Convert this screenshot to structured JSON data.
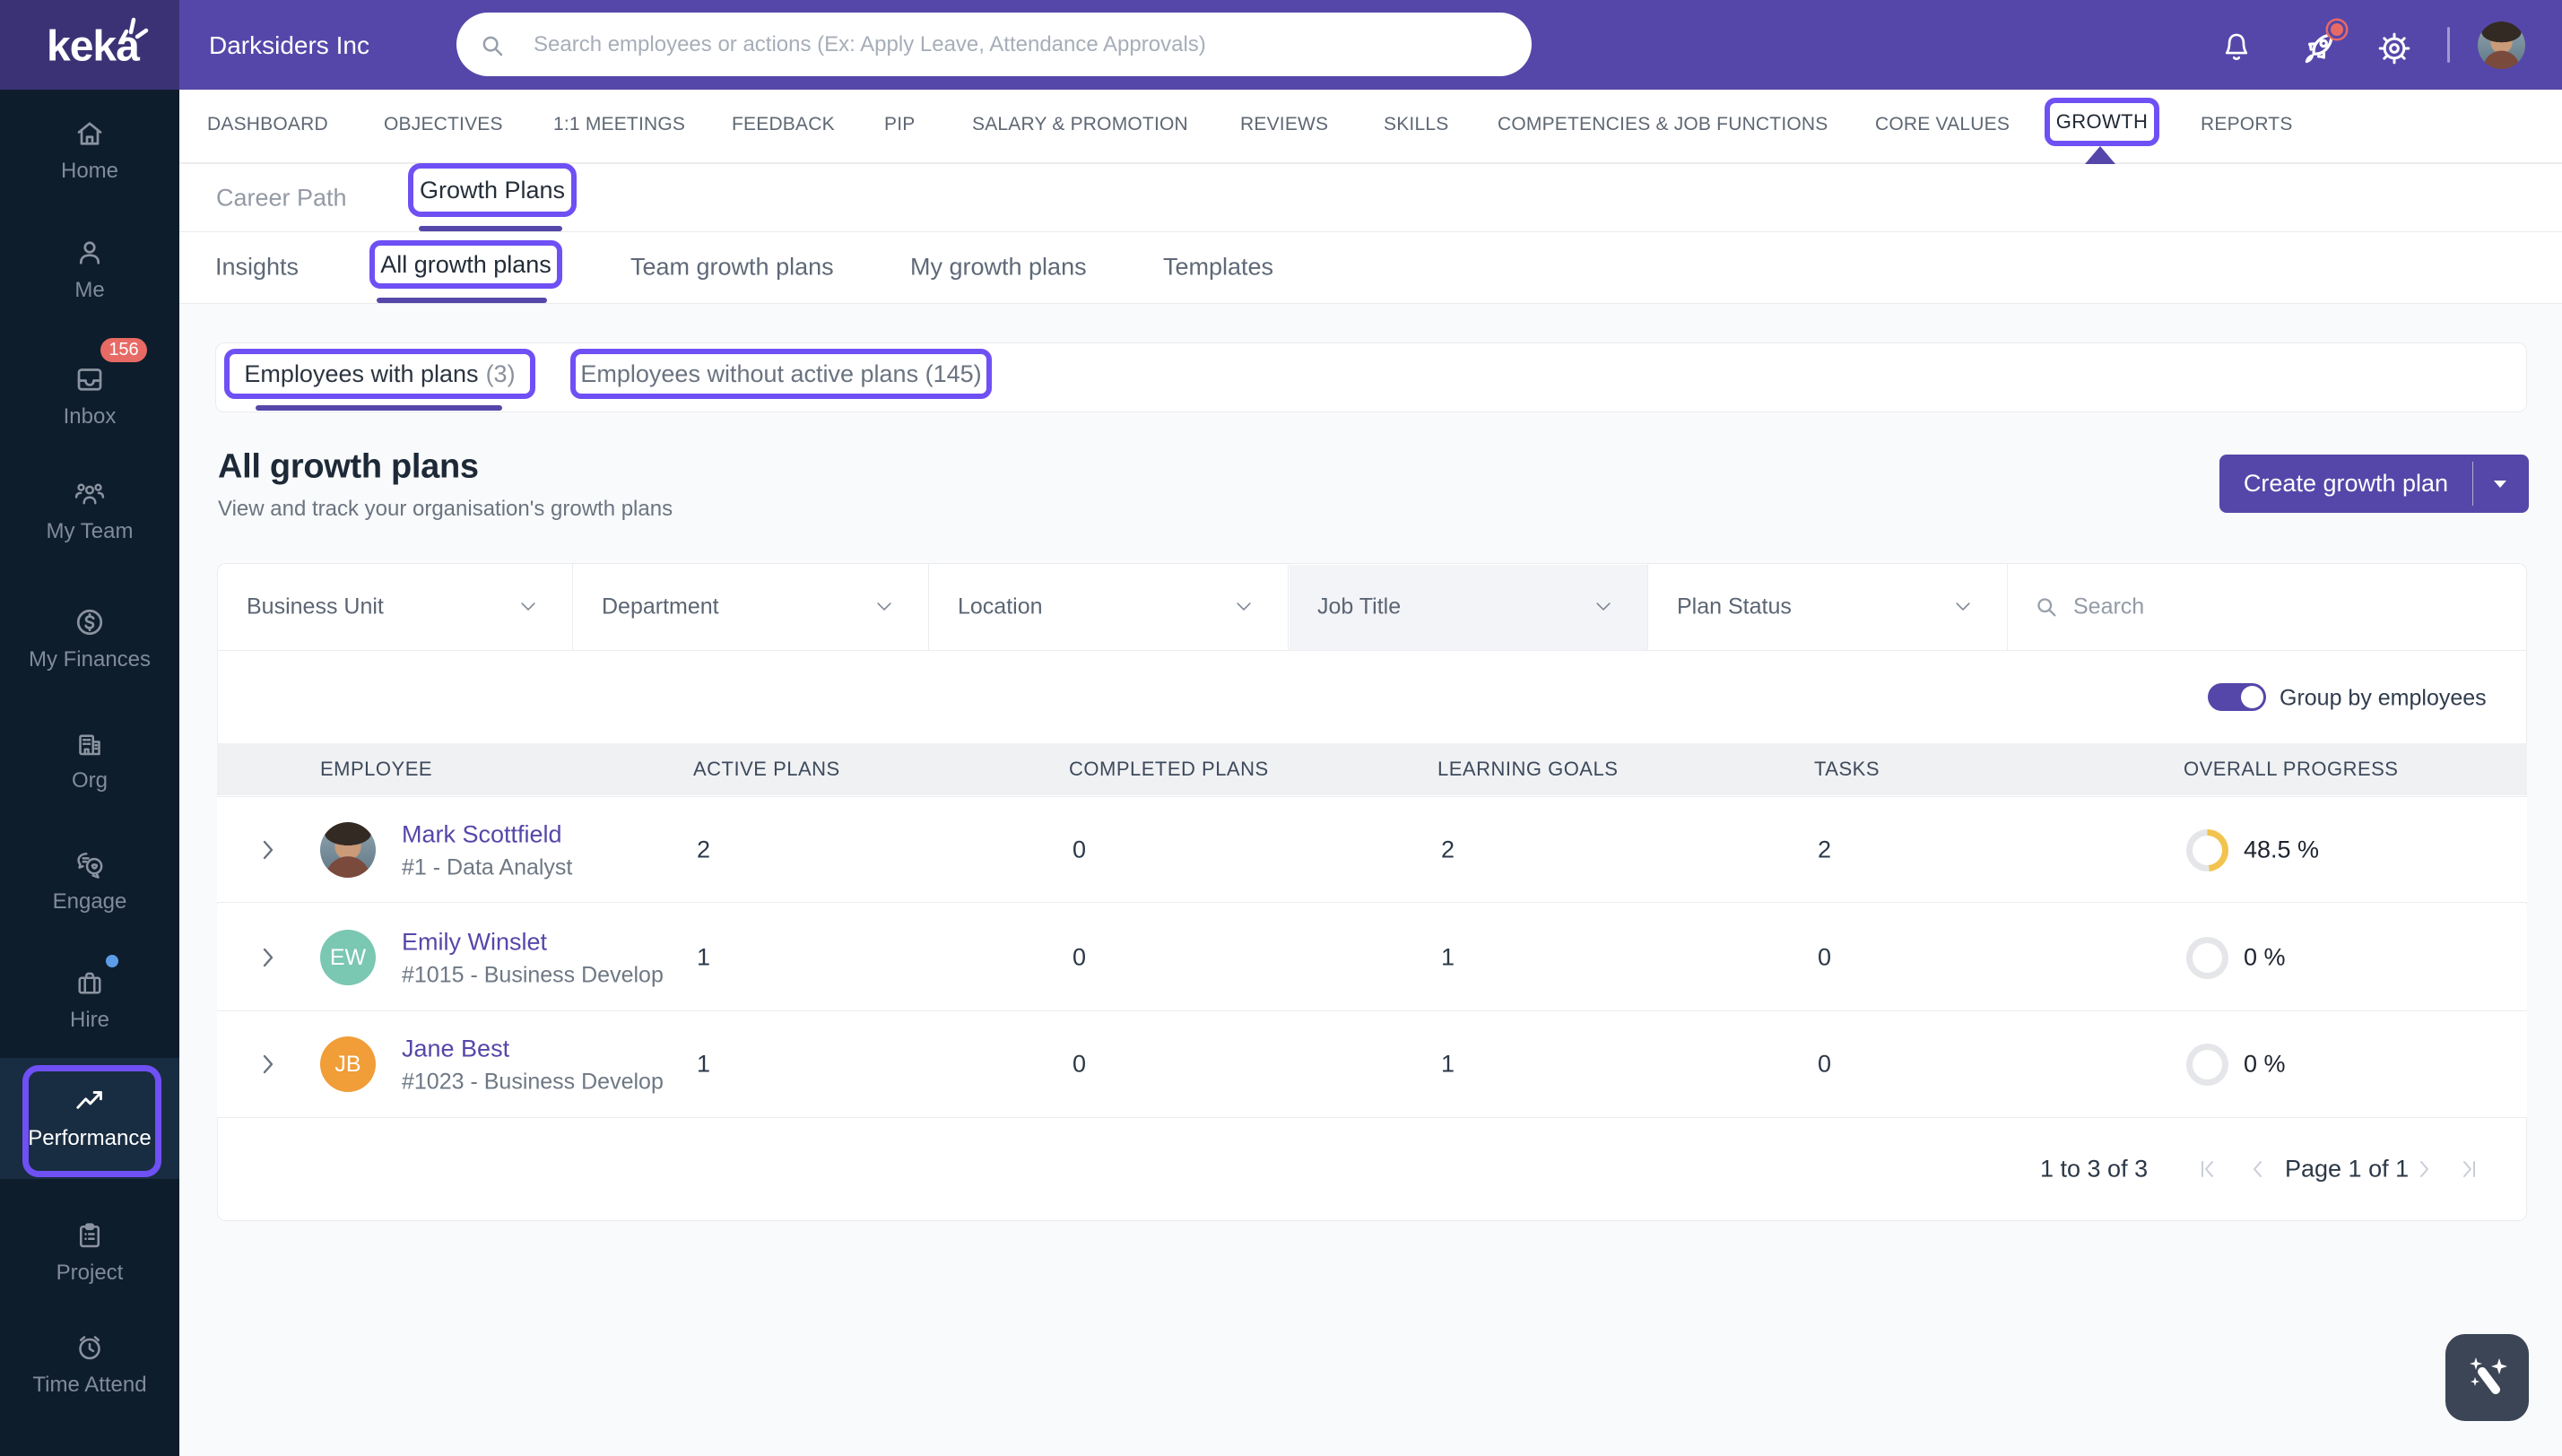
{
  "header": {
    "logo": "keka",
    "company": "Darksiders Inc",
    "search_placeholder": "Search employees or actions (Ex: Apply Leave, Attendance Approvals)",
    "chat_badge_dot": true
  },
  "sidebar": {
    "items": [
      {
        "label": "Home"
      },
      {
        "label": "Me"
      },
      {
        "label": "Inbox",
        "badge": "156"
      },
      {
        "label": "My Team"
      },
      {
        "label": "My Finances"
      },
      {
        "label": "Org"
      },
      {
        "label": "Engage"
      },
      {
        "label": "Hire",
        "dot": true
      },
      {
        "label": "Performance",
        "active": true
      },
      {
        "label": "Project"
      },
      {
        "label": "Time Attend"
      }
    ]
  },
  "nav": {
    "items": [
      "DASHBOARD",
      "OBJECTIVES",
      "1:1 MEETINGS",
      "FEEDBACK",
      "PIP",
      "SALARY & PROMOTION",
      "REVIEWS",
      "SKILLS",
      "COMPETENCIES & JOB FUNCTIONS",
      "CORE VALUES",
      "GROWTH",
      "REPORTS"
    ],
    "active": "GROWTH"
  },
  "subnav": {
    "items": [
      "Career Path",
      "Growth Plans"
    ],
    "active": "Growth Plans"
  },
  "tabs": {
    "items": [
      "Insights",
      "All growth plans",
      "Team growth plans",
      "My growth plans",
      "Templates"
    ],
    "active": "All growth plans"
  },
  "employee_tabs": {
    "with_plans_label": "Employees with plans",
    "with_plans_count": "(3)",
    "without_plans_label": "Employees without active plans (145)"
  },
  "page": {
    "title": "All growth plans",
    "subtitle": "View and track your organisation's growth plans",
    "create_button": "Create growth plan"
  },
  "filters": {
    "items": [
      "Business Unit",
      "Department",
      "Location",
      "Job Title",
      "Plan Status"
    ],
    "search_placeholder": "Search"
  },
  "toggle": {
    "label": "Group by employees",
    "on": true
  },
  "table": {
    "columns": [
      "EMPLOYEE",
      "ACTIVE PLANS",
      "COMPLETED PLANS",
      "LEARNING GOALS",
      "TASKS",
      "OVERALL PROGRESS"
    ],
    "rows": [
      {
        "name": "Mark Scottfield",
        "meta": "#1 - Data Analyst",
        "initials": "",
        "avatar": "photo",
        "active_plans": "2",
        "completed_plans": "0",
        "learning_goals": "2",
        "tasks": "2",
        "progress_label": "48.5 %",
        "progress_pct": 48.5
      },
      {
        "name": "Emily Winslet",
        "meta": "#1015 - Business Develop",
        "initials": "EW",
        "avatar": "#7ac7b2",
        "active_plans": "1",
        "completed_plans": "0",
        "learning_goals": "1",
        "tasks": "0",
        "progress_label": "0 %",
        "progress_pct": 0
      },
      {
        "name": "Jane Best",
        "meta": "#1023 - Business Develop",
        "initials": "JB",
        "avatar": "#f19d38",
        "active_plans": "1",
        "completed_plans": "0",
        "learning_goals": "1",
        "tasks": "0",
        "progress_label": "0 %",
        "progress_pct": 0
      }
    ]
  },
  "pagination": {
    "range": "1 to 3 of 3",
    "page": "Page 1 of 1"
  },
  "colors": {
    "header": "#5547a9",
    "logo_box": "#3b3276",
    "sidebar": "#0e1d2b",
    "sidebar_active": "#192d42",
    "annotation": "#6f50f4",
    "accent": "#5547a9",
    "badge": "#e86a65",
    "progress_arc": "#f2c34f",
    "progress_track": "#e5e6e9",
    "content_bg": "#f9fafb"
  }
}
